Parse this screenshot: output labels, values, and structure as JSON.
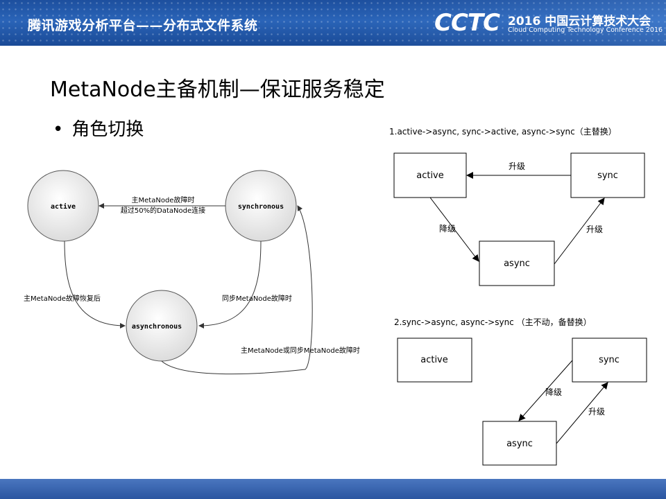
{
  "header": {
    "title": "腾讯游戏分析平台——分布式文件系统",
    "logo": "CCTC",
    "conference_cn": "2016 中国云计算技术大会",
    "conference_en": "Cloud Computing Technology Conference 2016"
  },
  "slide": {
    "title": "MetaNode主备机制—保证服务稳定",
    "bullet": "角色切换"
  },
  "state_diagram": {
    "nodes": {
      "active": "active",
      "synchronous": "synchronous",
      "asynchronous": "asynchronous"
    },
    "edges": {
      "sync_to_active_line1": "主MetaNode故障时",
      "sync_to_active_line2": "超过50%的DataNode连接",
      "active_to_async": "主MetaNode故障恢复后",
      "sync_to_async": "同步MetaNode故障时",
      "async_to_sync": "主MetaNode或同步MetaNode故障时"
    }
  },
  "scenario1": {
    "caption": "1.active->async, sync->active, async->sync（主替换）",
    "nodes": {
      "active": "active",
      "sync": "sync",
      "async": "async"
    },
    "edges": {
      "sync_to_active": "升级",
      "active_to_async": "降级",
      "async_to_sync": "升级"
    }
  },
  "scenario2": {
    "caption": "2.sync->async, async->sync （主不动，备替换）",
    "nodes": {
      "active": "active",
      "sync": "sync",
      "async": "async"
    },
    "edges": {
      "sync_to_async": "降级",
      "async_to_sync": "升级"
    }
  }
}
